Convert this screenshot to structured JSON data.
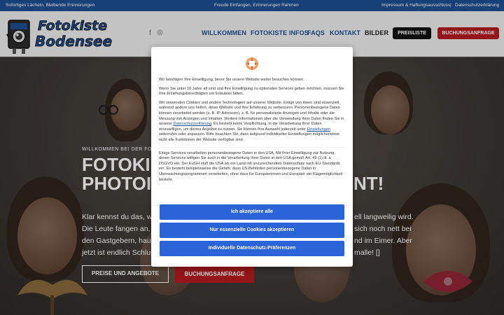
{
  "topbar": {
    "left": "Sofortiges Lächeln, Bleibende Erinnerungen",
    "center": "Freude Einfangen, Erinnerungen Rahmen",
    "impressum": "Impressum & Haftungsausschluss",
    "separator": "|",
    "datenschutz": "Datenschutzerklärung"
  },
  "logo": {
    "line1": "Fotokiste",
    "line2": "Bodensee"
  },
  "social": {
    "facebook": "f",
    "instagram": "◎"
  },
  "nav": {
    "items": [
      {
        "label": "WILLKOMMEN"
      },
      {
        "label": "FOTOKISTE INFOS"
      },
      {
        "label": "FAQS"
      },
      {
        "label": "KONTAKT"
      },
      {
        "label": "BILDER"
      }
    ],
    "preisliste": "PREISLISTE",
    "buchung": "BUCHUNGSANFRAGE"
  },
  "hero": {
    "kicker": "WILLKOMMEN BEI DER FOTO",
    "title_line1": "FOTOKI",
    "title_line2": "PHOTOI",
    "title_right": "NT!",
    "text_left": [
      "Klar kennst du das, we",
      "Die Leute fangen an, it",
      "den Gastgebern, haue",
      "jetzt ist endlich Schlus"
    ],
    "text_right": [
      "ell langweilig wird.",
      "sich noch nett bei",
      "nd im Eimer. Aber",
      "malle! []"
    ],
    "button_preise": "PREISE UND ANGEBOTE",
    "button_buchung": "BUCHUNGSANFRAGE"
  },
  "consent": {
    "p1": "Wir benötigen Ihre Einwilligung, bevor Sie unsere Website weiter besuchen können.",
    "p2": "Wenn Sie unter 16 Jahre alt sind und Ihre Einwilligung zu optionalen Services geben möchten, müssen Sie Ihre Erziehungsberechtigten um Erlaubnis bitten.",
    "p3_a": "Wir verwenden Cookies und andere Technologien auf unserer Website. Einige von ihnen sind essenziell, während andere uns helfen, diese Website und Ihre Erfahrung zu verbessern. Personenbezogene Daten können verarbeitet werden (z. B. IP-Adressen), z. B. für personalisierte Anzeigen und Inhalte oder die Messung von Anzeigen und Inhalten. Weitere Informationen über die Verwendung Ihrer Daten finden Sie in unserer ",
    "p3_link1": "Datenschutzerklärung",
    "p3_b": ". Es besteht keine Verpflichtung, in die Verarbeitung Ihrer Daten einzuwilligen, um dieses Angebot zu nutzen. Sie können Ihre Auswahl jederzeit unter ",
    "p3_link2": "Einstellungen",
    "p3_c": " widerrufen oder anpassen. Bitte beachten Sie, dass aufgrund individueller Einstellungen möglicherweise nicht alle Funktionen der Website verfügbar sind.",
    "p4": "Einige Services verarbeiten personenbezogene Daten in den USA. Mit Ihrer Einwilligung zur Nutzung dieser Services willigen Sie auch in die Verarbeitung Ihrer Daten in den USA gemäß Art. 49 (1) lit. a DSGVO ein. Der EuGH stuft die USA als ein Land mit unzureichendem Datenschutz nach EU-Standards ein. Es besteht beispielsweise die Gefahr, dass US-Behörden personenbezogene Daten in Überwachungsprogrammen verarbeiten, ohne dass für Europäerinnen und Europäer ein Klagemöglichkeit besteht.",
    "accept_all": "Ich akzeptiere alle",
    "essential_only": "Nur essenzielle Cookies akzeptieren",
    "individual": "Individuelle Datenschutz-Präferenzen"
  },
  "colors": {
    "topbar": "#1d4f93",
    "nav": "#1d4f93",
    "cta_red": "#b51c20",
    "consent_blue": "#2b63d9"
  }
}
